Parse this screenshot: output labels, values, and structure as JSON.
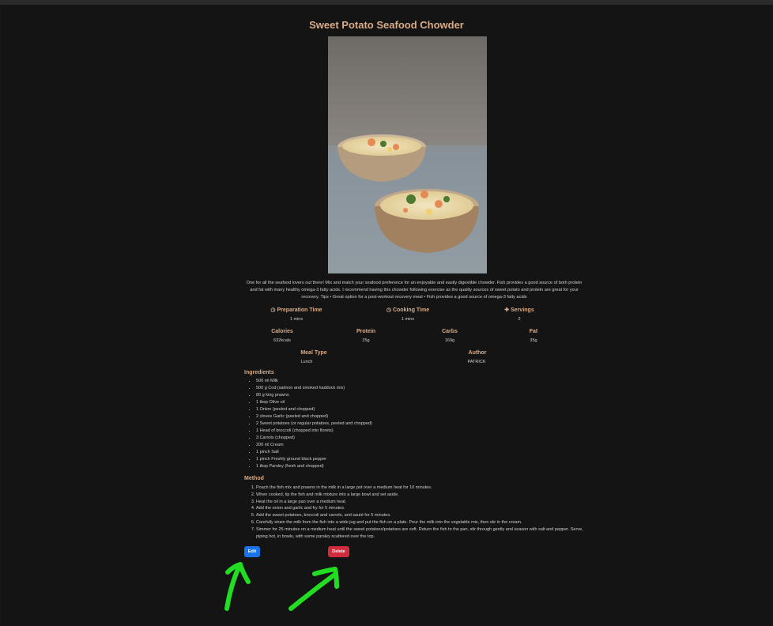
{
  "recipe": {
    "title": "Sweet Potato Seafood Chowder",
    "description": "One for all the seafood lovers out there! Mix and match your seafood preference for an enjoyable and easily digestible chowder. Fish provides a good source of both protein and fat with many healthy omega-3 fatty acids. I recommend having this chowder following exercise as the quality sources of sweet potato and protein are great for your recovery. Tips • Great option for a post-workout recovery meal • Fish provides a good source of omega-3 fatty acids",
    "prep": {
      "label": "Preparation Time",
      "value": "1 mins",
      "icon": "clock-icon"
    },
    "cook": {
      "label": "Cooking Time",
      "value": "1 mins",
      "icon": "clock-icon"
    },
    "servings": {
      "label": "Servings",
      "value": "2",
      "icon": "utensils-icon"
    },
    "calories": {
      "label": "Calories",
      "value": "632kcals"
    },
    "protein": {
      "label": "Protein",
      "value": "25g"
    },
    "carbs": {
      "label": "Carbs",
      "value": "169g"
    },
    "fat": {
      "label": "Fat",
      "value": "35g"
    },
    "meal_type": {
      "label": "Meal Type",
      "value": "Lunch"
    },
    "author": {
      "label": "Author",
      "value": "PATRICK"
    },
    "ingredients_heading": "Ingredients",
    "ingredients": [
      "500 ml Milk",
      "500 g Cod (salmon and smoked haddock mix)",
      "80 g king prawns",
      "1 tbsp Olive oil",
      "1 Onion (peeled and chopped)",
      "2 cloves Garlic (peeled and chopped)",
      "2 Sweet potatoes (or regular potatoes, peeled and chopped)",
      "1 Head of broccoli (chopped into florets)",
      "3 Carrots (chopped)",
      "200 ml Cream",
      "1 pinch Salt",
      "1 pinch Freshly ground black pepper",
      "1 tbsp Parsley (fresh and chopped)"
    ],
    "method_heading": "Method",
    "method": [
      "Poach the fish mix and prawns in the milk in a large pot over a medium heat for 10 minutes.",
      "When cooked, tip the fish and milk mixture into a large bowl and set aside.",
      "Heat the oil in a large pan over a medium heat.",
      "Add the onion and garlic and fry for 5 minutes.",
      "Add the sweet potatoes, broccoli and carrots, and sauté for 5 minutes.",
      "Carefully strain the milk from the fish into a wide jug and put the fish on a plate. Pour the milk into the vegetable mix, then stir in the cream.",
      "Simmer for 25 minutes on a medium heat until the sweet potatoes/potatoes are soft. Return the fish to the pan, stir through gently and season with salt and pepper. Serve, piping hot, in bowls, with some parsley scattered over the top."
    ]
  },
  "actions": {
    "edit_label": "Edit",
    "delete_label": "Delete"
  },
  "colors": {
    "background": "#141414",
    "accent": "#d9ab86",
    "edit": "#1a73e8",
    "delete": "#d12b3e",
    "annotation_arrow": "#22dd22"
  }
}
